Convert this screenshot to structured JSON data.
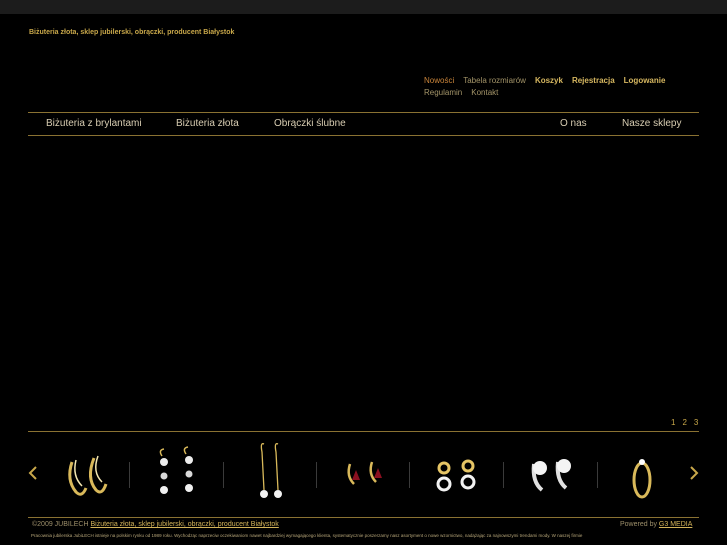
{
  "site": {
    "tagline": "Biżuteria złota, sklep jubilerski, obrączki, producent Białystok"
  },
  "toplinks": {
    "row1": [
      "Nowości",
      "Tabela rozmiarów",
      "Koszyk",
      "Rejestracja",
      "Logowanie"
    ],
    "row2": [
      "Regulamin",
      "Kontakt"
    ]
  },
  "nav": {
    "left": [
      "Biżuteria z brylantami",
      "Biżuteria złota",
      "Obrączki ślubne"
    ],
    "right": [
      "O nas",
      "Nasze sklepy"
    ]
  },
  "pager": [
    "1",
    "2",
    "3"
  ],
  "carousel": {
    "items": [
      "hoop-earrings",
      "pearl-drop-earrings",
      "long-hook-earrings",
      "ruby-earrings",
      "double-circle-earrings",
      "pearl-stud-earrings",
      "diamond-ring"
    ]
  },
  "footer": {
    "copyright": "©2009 JUBILECH",
    "link": "Biżuteria złota, sklep jubilerski, obrączki, producent Białystok",
    "powered_prefix": "Powered by",
    "powered_link": "G3 MEDIA",
    "fine_text": "Pracownia jubilerska JubiLECH istnieje na polskim rynku od 1989 roku. Wychodząc naprzeciw oczekiwaniom nawet najbardziej wymagającego klienta, systematycznie poszerzamy nasz asortyment o nowe wzornictwo, nadążając za najnowszymi trendami mody. W naszej firmie"
  },
  "colors": {
    "accent": "#c9a84a",
    "line": "#8a7232",
    "background": "#000000"
  }
}
